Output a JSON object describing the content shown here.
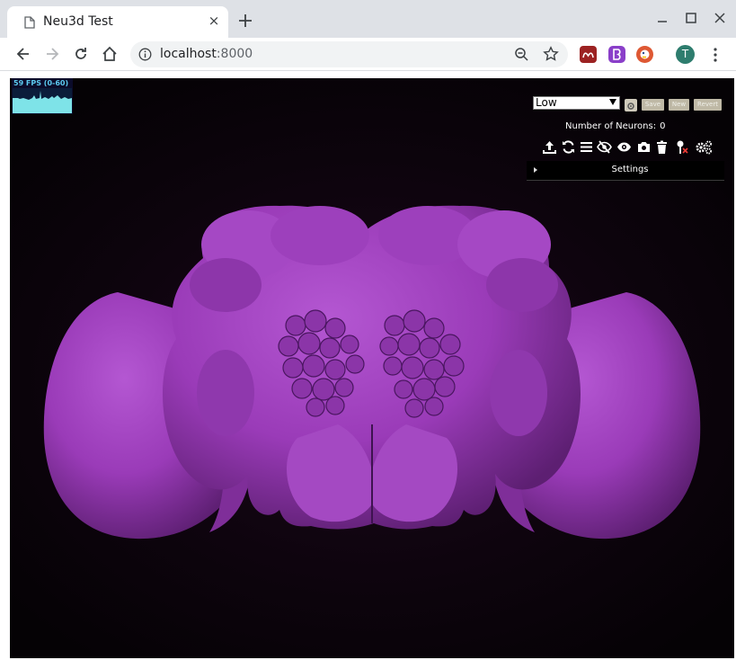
{
  "browser": {
    "tab_title": "Neu3d Test",
    "tab_close": "×",
    "url_host": "localhost",
    "url_port": ":8000",
    "profile_initial": "T",
    "extensions": [
      "mendeley-icon",
      "bitwarden-icon",
      "duckduckgo-icon"
    ]
  },
  "fps": {
    "label": "59 FPS (0-60)"
  },
  "controls": {
    "quality_value": "Low",
    "save_label": "Save",
    "new_label": "New",
    "revert_label": "Revert",
    "neurons_label": "Number of Neurons:",
    "neurons_count": "0",
    "settings_label": "Settings"
  },
  "colors": {
    "brain": "#9a3bb8",
    "background": "#0a030a",
    "fps_text": "#5ccaf0",
    "button_bg": "#bfb9a6"
  }
}
